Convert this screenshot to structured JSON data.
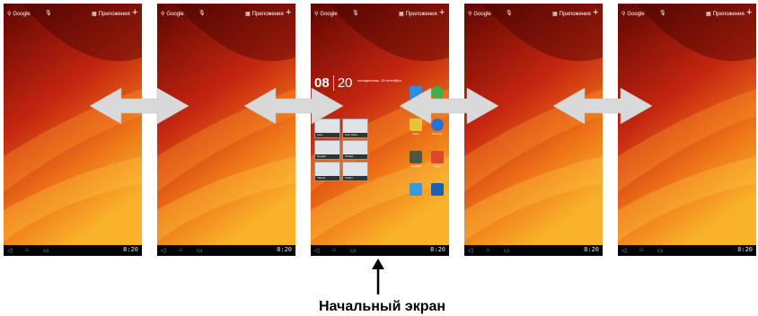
{
  "screens": [
    {
      "google_label": "Google",
      "apps_label": "Приложения",
      "time": "8:20"
    },
    {
      "google_label": "Google",
      "apps_label": "Приложения",
      "time": "8:20"
    },
    {
      "google_label": "Google",
      "apps_label": "Приложения",
      "time": "8:20",
      "clock": {
        "hours": "08",
        "minutes": "20",
        "date": "понедельник, 15 сентября"
      },
      "widget_cards": [
        "Acer",
        "Acer Store",
        "Google",
        "Picasa",
        "Yahoo!",
        "Twitter"
      ],
      "apps": [
        "",
        "",
        "Maps",
        "Browser",
        "Reading",
        "Store",
        "",
        ""
      ]
    },
    {
      "google_label": "Google",
      "apps_label": "Приложения",
      "time": "8:20"
    },
    {
      "google_label": "Google",
      "apps_label": "Приложения",
      "time": "8:20"
    }
  ],
  "caption": "Начальный экран",
  "colors": {
    "arrow": "#d9d9d9",
    "wallpaper_dark": "#6e0904",
    "wallpaper_mid": "#c9250e",
    "wallpaper_light": "#f6a21c"
  }
}
